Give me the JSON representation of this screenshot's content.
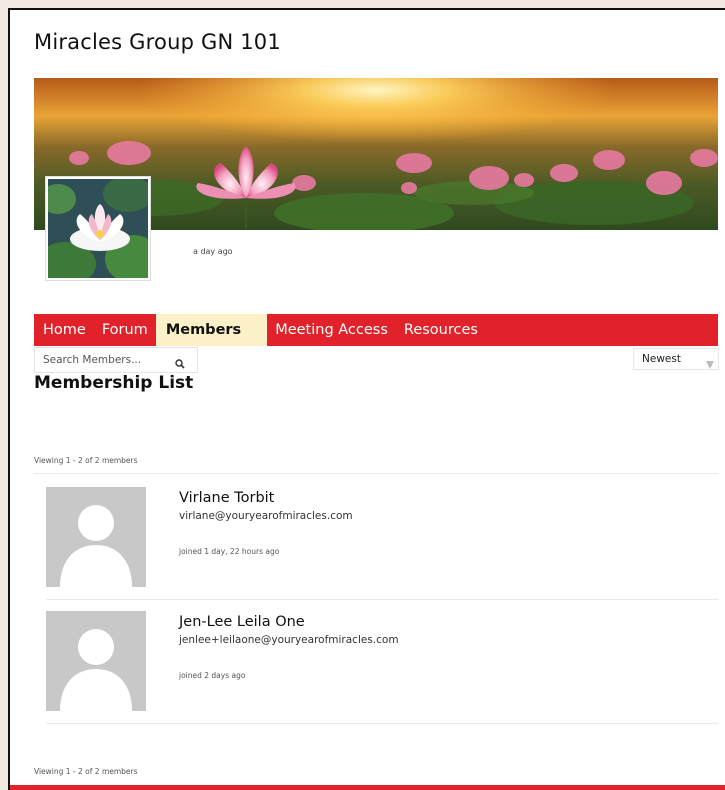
{
  "group": {
    "title": "Miracles Group GN 101",
    "last_active": "a day ago"
  },
  "nav": {
    "items": [
      {
        "label": "Home"
      },
      {
        "label": "Forum"
      },
      {
        "label": "Members"
      },
      {
        "label": "Meeting Access"
      },
      {
        "label": "Resources"
      }
    ],
    "active_index": 2
  },
  "search": {
    "placeholder": "Search Members..."
  },
  "sort": {
    "selected": "Newest"
  },
  "members_section": {
    "title": "Membership List",
    "count_text_top": "Viewing 1 - 2 of 2 members",
    "count_text_bottom": "Viewing 1 - 2 of 2 members",
    "members": [
      {
        "name": "Virlane Torbit",
        "email": "virlane@youryearofmiracles.com",
        "joined": "joined 1 day, 22 hours ago"
      },
      {
        "name": "Jen-Lee Leila One",
        "email": "jenlee+leilaone@youryearofmiracles.com",
        "joined": "joined 2 days ago"
      }
    ]
  },
  "colors": {
    "accent": "#e1222b",
    "active_tab": "#fbf0c7",
    "page_bg": "#f3ebe3"
  },
  "icons": {
    "search": "magnifier-icon",
    "sort": "triangle-down-icon"
  }
}
